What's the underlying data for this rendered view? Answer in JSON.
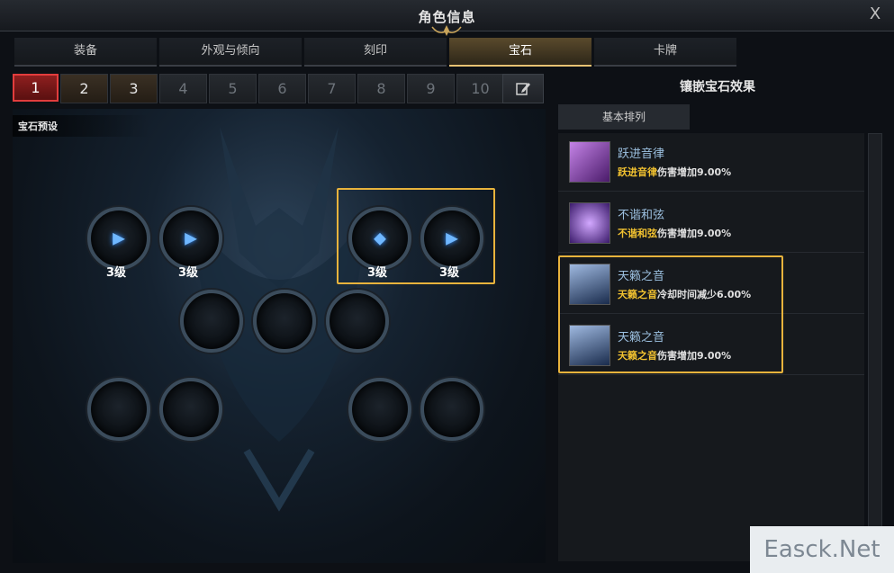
{
  "window": {
    "title": "角色信息",
    "close_label": "X"
  },
  "tabs": [
    {
      "label": "装备"
    },
    {
      "label": "外观与倾向"
    },
    {
      "label": "刻印"
    },
    {
      "label": "宝石",
      "active": true
    },
    {
      "label": "卡牌"
    }
  ],
  "presets": [
    "1",
    "2",
    "3",
    "4",
    "5",
    "6",
    "7",
    "8",
    "9",
    "10"
  ],
  "preset_active": "1",
  "gem_panel": {
    "label": "宝石预设"
  },
  "slots": [
    {
      "level": "3级",
      "gem": "attack"
    },
    {
      "level": "3级",
      "gem": "attack"
    },
    {
      "level": "3级",
      "gem": "cooldown"
    },
    {
      "level": "3级",
      "gem": "attack"
    },
    {
      "level": ""
    },
    {
      "level": ""
    },
    {
      "level": ""
    },
    {
      "level": ""
    },
    {
      "level": ""
    },
    {
      "level": ""
    },
    {
      "level": ""
    }
  ],
  "right": {
    "title": "镶嵌宝石效果",
    "sort_tab": "基本排列",
    "effects": [
      {
        "name": "跃进音律",
        "highlight": "跃进音律",
        "desc": "伤害增加9.00%",
        "icon": "skill-leap-icon",
        "color": "#8a3fb0"
      },
      {
        "name": "不谐和弦",
        "highlight": "不谐和弦",
        "desc": "伤害增加9.00%",
        "icon": "skill-dissonance-icon",
        "color": "#6a3fa8"
      },
      {
        "name": "天籁之音",
        "highlight": "天籁之音",
        "desc": "冷却时间减少6.00%",
        "icon": "skill-heavenly-icon",
        "color": "#2b4f86"
      },
      {
        "name": "天籁之音",
        "highlight": "天籁之音",
        "desc": "伤害增加9.00%",
        "icon": "skill-heavenly-icon",
        "color": "#2b4f86"
      }
    ]
  },
  "watermark": "Easck.Net"
}
